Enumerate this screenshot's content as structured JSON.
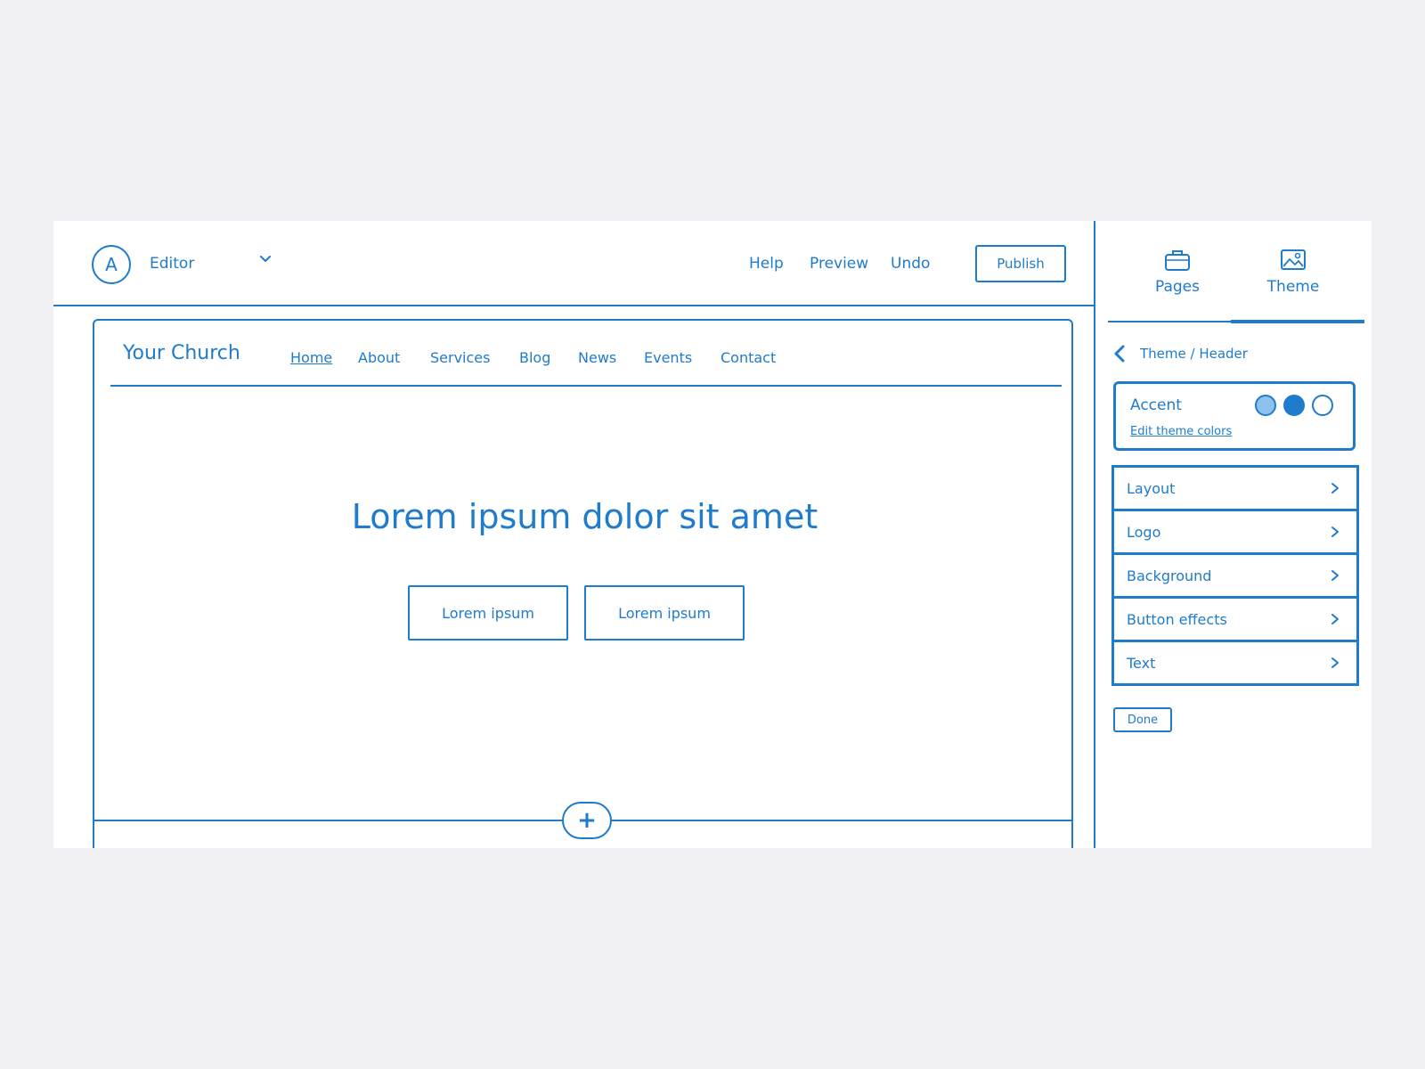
{
  "colors": {
    "accent": "#1f7bcc",
    "background": "#f1f1f5",
    "surface": "#ffffff",
    "swatch_light": "#8ec2ec"
  },
  "topbar": {
    "avatar_letter": "A",
    "editor_label": "Editor",
    "links": {
      "help": "Help",
      "preview": "Preview",
      "undo": "Undo"
    },
    "publish_label": "Publish",
    "icons": [
      "chevron-down-icon"
    ]
  },
  "site": {
    "title": "Your Church",
    "nav": [
      "Home",
      "About",
      "Services",
      "Blog",
      "News",
      "Events",
      "Contact"
    ],
    "hero_title": "Lorem ipsum dolor sit amet",
    "hero_buttons": [
      "Lorem ipsum",
      "Lorem ipsum"
    ],
    "add_section_symbol": "+"
  },
  "panel": {
    "tabs": [
      {
        "label": "Pages",
        "icon": "briefcase-icon"
      },
      {
        "label": "Theme",
        "icon": "image-icon"
      }
    ],
    "active_tab": "Theme",
    "breadcrumb": "Theme / Header",
    "accent": {
      "label": "Accent",
      "link": "Edit theme colors",
      "swatches": [
        "#8ec2ec",
        "#1f7bcc",
        "#ffffff"
      ]
    },
    "settings": [
      "Layout",
      "Logo",
      "Background",
      "Button effects",
      "Text"
    ],
    "done_label": "Done"
  }
}
